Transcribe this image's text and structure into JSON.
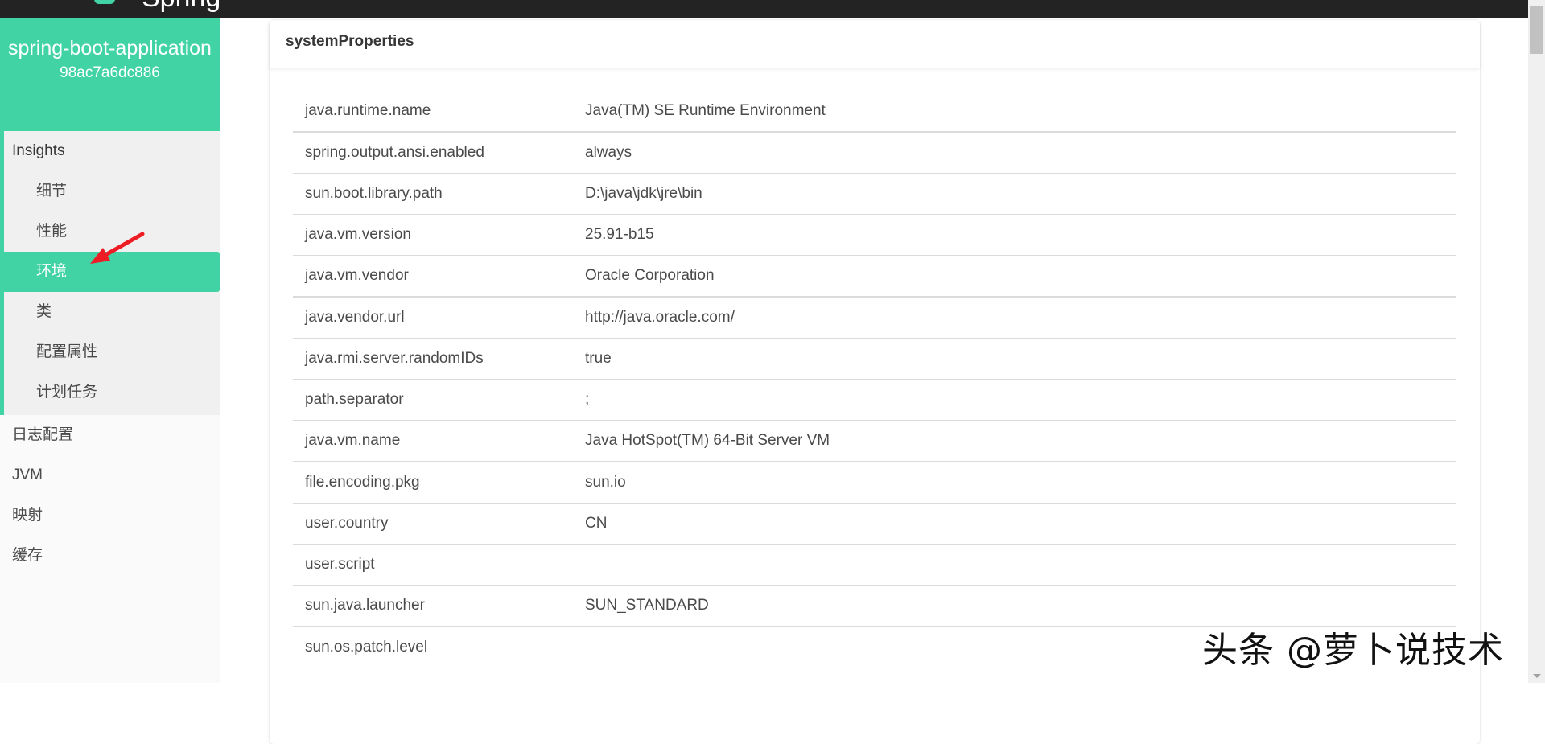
{
  "topbar": {
    "brand": "Spring"
  },
  "app": {
    "name": "spring-boot-application",
    "id": "98ac7a6dc886"
  },
  "sidebar": {
    "group": {
      "title": "Insights",
      "items": [
        {
          "label": "细节",
          "active": false
        },
        {
          "label": "性能",
          "active": false
        },
        {
          "label": "环境",
          "active": true
        },
        {
          "label": "类",
          "active": false
        },
        {
          "label": "配置属性",
          "active": false
        },
        {
          "label": "计划任务",
          "active": false
        }
      ]
    },
    "items": [
      {
        "label": "日志配置"
      },
      {
        "label": "JVM"
      },
      {
        "label": "映射"
      },
      {
        "label": "缓存"
      }
    ]
  },
  "card": {
    "title": "systemProperties",
    "rows": [
      {
        "key": "java.runtime.name",
        "value": "Java(TM) SE Runtime Environment"
      },
      {
        "key": "spring.output.ansi.enabled",
        "value": "always"
      },
      {
        "key": "sun.boot.library.path",
        "value": "D:\\java\\jdk\\jre\\bin"
      },
      {
        "key": "java.vm.version",
        "value": "25.91-b15"
      },
      {
        "key": "java.vm.vendor",
        "value": "Oracle Corporation"
      },
      {
        "key": "java.vendor.url",
        "value": "http://java.oracle.com/"
      },
      {
        "key": "java.rmi.server.randomIDs",
        "value": "true"
      },
      {
        "key": "path.separator",
        "value": ";"
      },
      {
        "key": "java.vm.name",
        "value": "Java HotSpot(TM) 64-Bit Server VM"
      },
      {
        "key": "file.encoding.pkg",
        "value": "sun.io"
      },
      {
        "key": "user.country",
        "value": "CN"
      },
      {
        "key": "user.script",
        "value": ""
      },
      {
        "key": "sun.java.launcher",
        "value": "SUN_STANDARD"
      },
      {
        "key": "sun.os.patch.level",
        "value": ""
      }
    ]
  },
  "watermark": "头条 @萝卜说技术",
  "colors": {
    "accent": "#42d3a5",
    "topbar": "#232323",
    "annotation_arrow": "#ee1c25"
  }
}
